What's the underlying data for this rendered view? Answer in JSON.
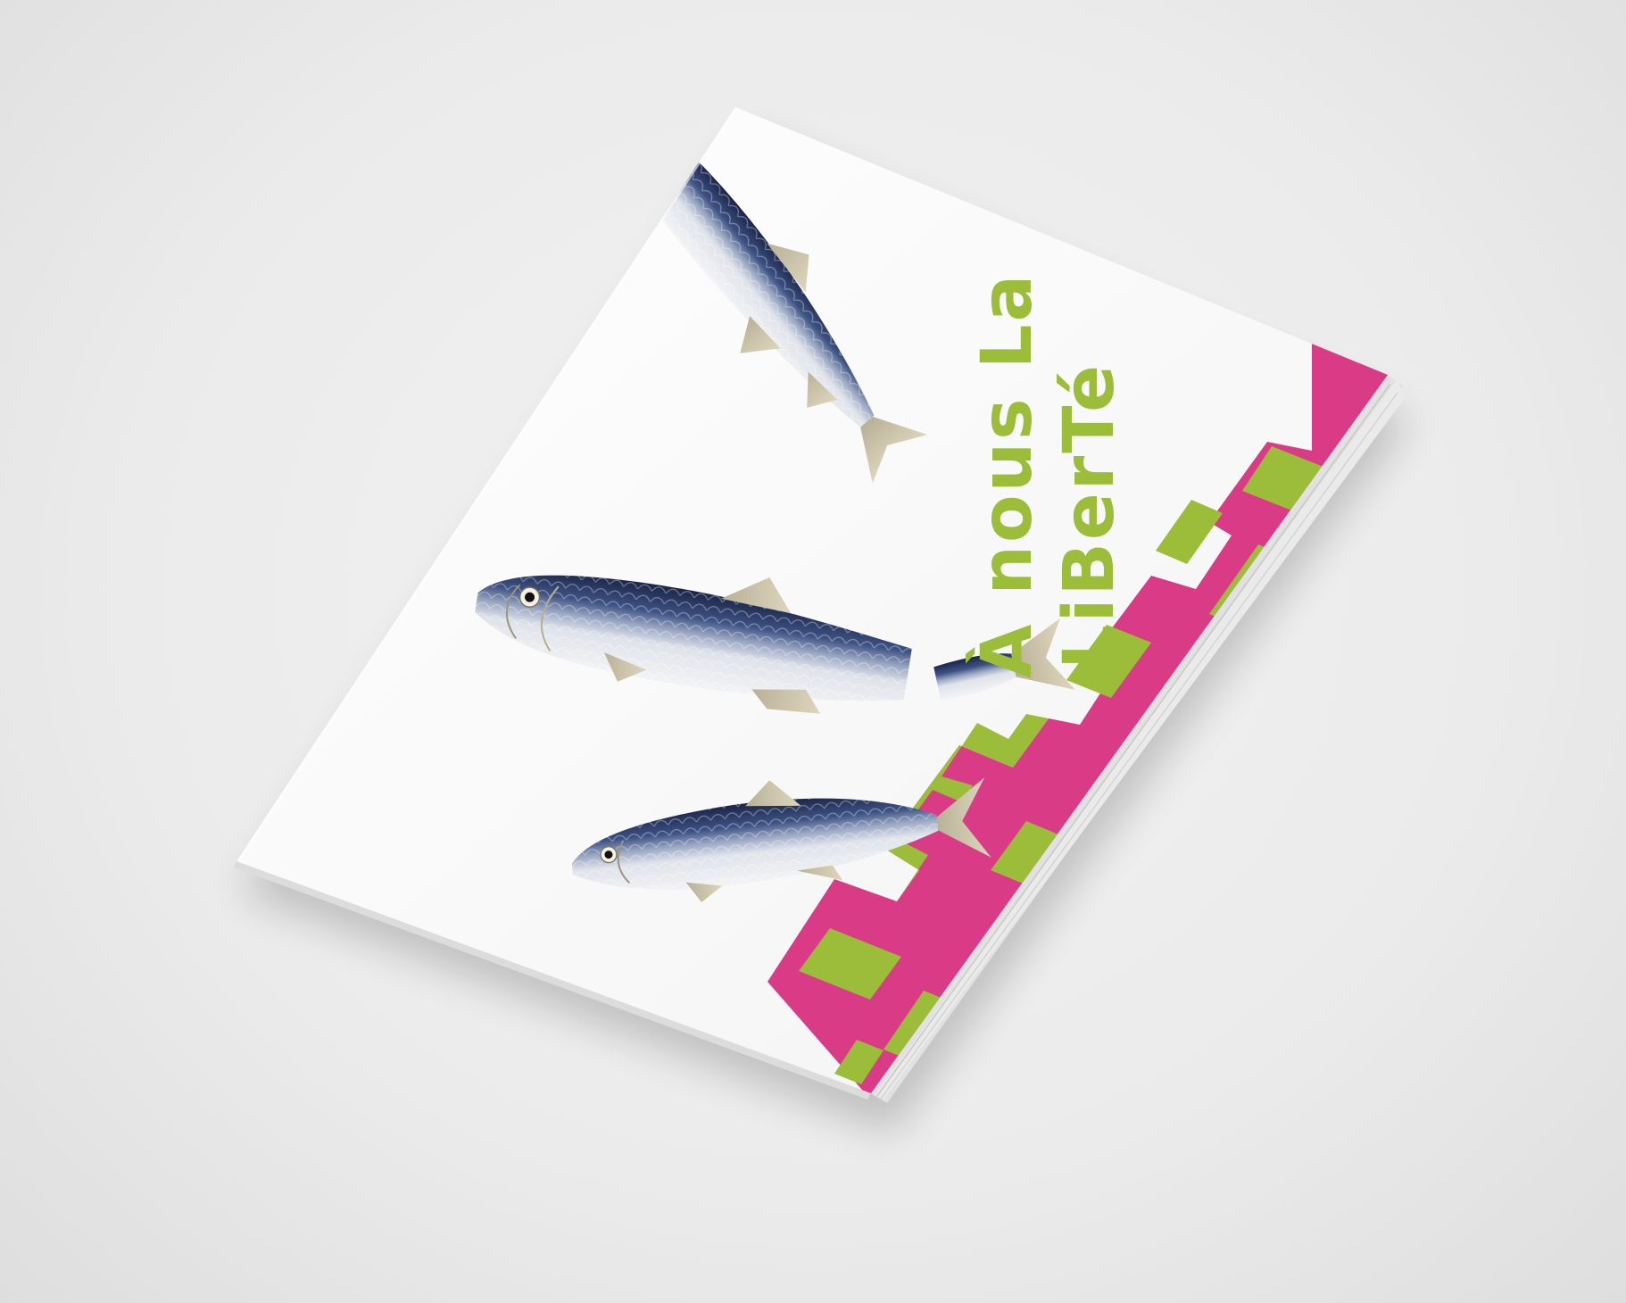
{
  "booklet": {
    "title_line_1": "À nous La",
    "title_line_2": "LiBerTé"
  },
  "colors": {
    "background": "#ebebeb",
    "paper": "#fbfbfb",
    "magenta": "#d93b86",
    "lime": "#9bbd3a",
    "fish_back": "#1f2a4e",
    "fish_mid": "#5a6f9a",
    "fish_belly": "#eeeff2",
    "fin": "#cfc6a8"
  },
  "fish": [
    {
      "name": "sardine-top",
      "cropped": true
    },
    {
      "name": "sardine-middle",
      "split": true
    },
    {
      "name": "sardine-bottom",
      "cropped": false
    }
  ]
}
